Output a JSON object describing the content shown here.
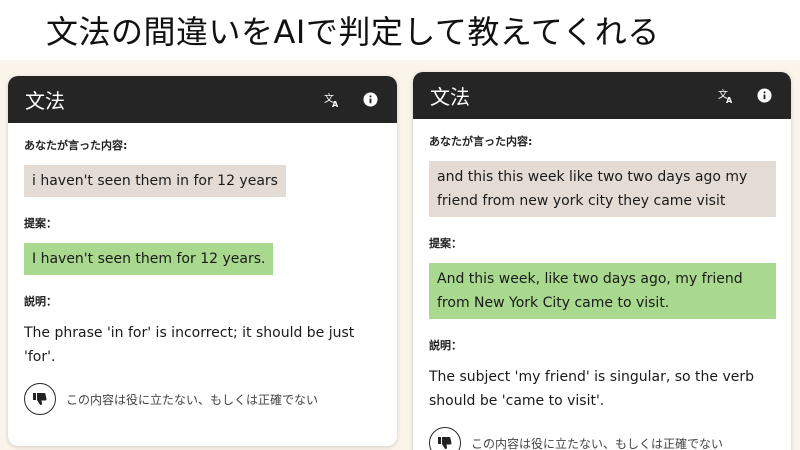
{
  "headline": "文法の間違いをAIで判定して教えてくれる",
  "colors": {
    "header_bg": "#252525",
    "said_bubble": "#e4dcd4",
    "suggestion_bubble": "#a8d98e",
    "stage_bg": "#fbf4ea"
  },
  "cards": [
    {
      "title": "文法",
      "icons": [
        "translate-icon",
        "info-icon"
      ],
      "said_label": "あなたが言った内容:",
      "said_text": "i haven't seen them in for 12 years",
      "suggestion_label": "提案：",
      "suggestion_text": "I haven't seen them for 12 years.",
      "explanation_label": "説明：",
      "explanation_text": "The phrase 'in for' is incorrect; it should be just 'for'.",
      "feedback_text": "この内容は役に立たない、もしくは正確でない"
    },
    {
      "title": "文法",
      "icons": [
        "translate-icon",
        "info-icon"
      ],
      "said_label": "あなたが言った内容:",
      "said_text": "and this this week like two two days ago my friend from new york city they came visit",
      "suggestion_label": "提案：",
      "suggestion_text": "And this week, like two days ago, my friend from New York City came to visit.",
      "explanation_label": "説明：",
      "explanation_text": "The subject 'my friend' is singular, so the verb should be 'came to visit'.",
      "feedback_text": "この内容は役に立たない、もしくは正確でない"
    }
  ]
}
